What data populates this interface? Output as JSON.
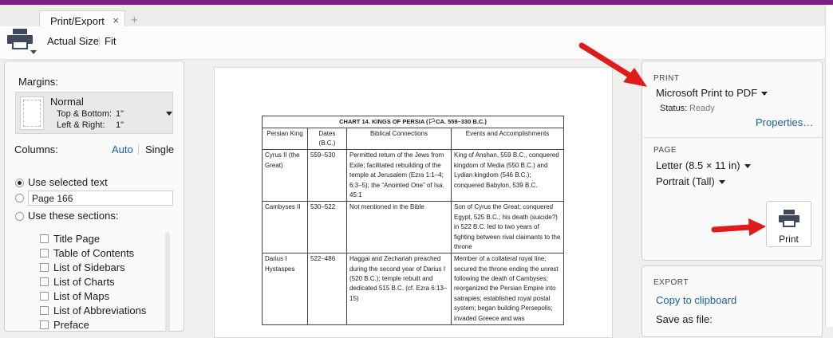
{
  "tab": {
    "label": "Print/Export",
    "close": "×",
    "new": "+"
  },
  "toolbar": {
    "actual_size": "Actual Size",
    "fit": "Fit"
  },
  "left": {
    "margins_label": "Margins:",
    "margins": {
      "name": "Normal",
      "tb_label": "Top & Bottom:",
      "tb_value": "1\"",
      "lr_label": "Left & Right:",
      "lr_value": "1\""
    },
    "columns_label": "Columns:",
    "columns_auto": "Auto",
    "columns_single": "Single",
    "use_selected": "Use selected text",
    "page_value": "Page 166",
    "use_sections": "Use these sections:",
    "sections": [
      "Title Page",
      "Table of Contents",
      "List of Sidebars",
      "List of Charts",
      "List of Maps",
      "List of Abbreviations",
      "Preface"
    ]
  },
  "preview": {
    "title": "CHART 14. KINGS OF PERSIA (",
    "title_flag": "🏳",
    "title_dates": "CA. 559–330 B.C.)",
    "headers": [
      "Persian King",
      "Dates (B.C.)",
      "Biblical Connections",
      "Events and Accomplishments"
    ],
    "rows": [
      {
        "king": "Cyrus II (the Great)",
        "dates": "559–530",
        "biblical": "Permitted return of the Jews from Exile; facilitated rebuilding of the temple at Jerusalem (Ezra 1:1–4; 6:3–5); the “Anointed One” of Isa. 45:1",
        "events": "King of Anshan, 559 B.C., conquered kingdom of Media (550 B.C.) and Lydian kingdom (546 B.C.); conquered Babylon, 539 B.C."
      },
      {
        "king": "Cambyses II",
        "dates": "530–522",
        "biblical": "Not mentioned in the Bible",
        "events": "Son of Cyrus the Great; conquered Egypt, 525 B.C.; his death (suicide?) in 522 B.C. led to two years of fighting between rival claimants to the throne"
      },
      {
        "king": "Darius I Hystaspes",
        "dates": "522–486",
        "biblical": "Haggai and Zechariah preached during the second year of Darius I (520 B.C.); temple rebuilt and dedicated 515 B.C. (cf. Ezra 6:13–15)",
        "events": "Member of a collateral royal line; secured the throne ending the unrest following the death of Cambyses; reorganized the Persian Empire into satrapies; established royal postal system; began building Persepolis; invaded Greece and was"
      }
    ]
  },
  "print": {
    "section": "PRINT",
    "printer": "Microsoft Print to PDF",
    "status_label": "Status:",
    "status_value": "Ready",
    "properties": "Properties…",
    "page_section": "PAGE",
    "paper": "Letter (8.5 × 11 in)",
    "orientation": "Portrait (Tall)",
    "print_button": "Print"
  },
  "export": {
    "section": "EXPORT",
    "copy": "Copy to clipboard",
    "save": "Save as file:"
  },
  "colors": {
    "accent_bar": "#7a1f86",
    "link": "#1a5fa0",
    "arrow": "#e01b1b"
  }
}
